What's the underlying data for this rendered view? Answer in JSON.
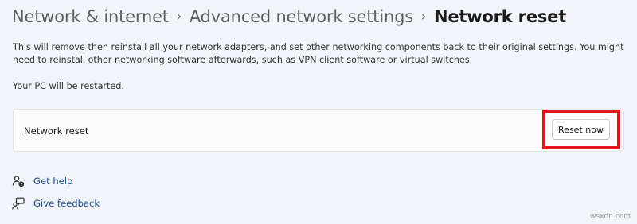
{
  "breadcrumb": {
    "items": [
      "Network & internet",
      "Advanced network settings"
    ],
    "current": "Network reset",
    "separator": "›"
  },
  "description": "This will remove then reinstall all your network adapters, and set other networking components back to their original settings. You might need to reinstall other networking software afterwards, such as VPN client software or virtual switches.",
  "restart_note": "Your PC will be restarted.",
  "card": {
    "label": "Network reset",
    "button_label": "Reset now"
  },
  "links": {
    "help": {
      "label": "Get help",
      "icon": "help-person-icon"
    },
    "feedback": {
      "label": "Give feedback",
      "icon": "feedback-icon"
    }
  },
  "watermark": "wsxdn.com",
  "colors": {
    "background": "#f1f4f8",
    "card": "#fbfbfb",
    "highlight": "#e0141e",
    "link": "#1a4b8e"
  }
}
